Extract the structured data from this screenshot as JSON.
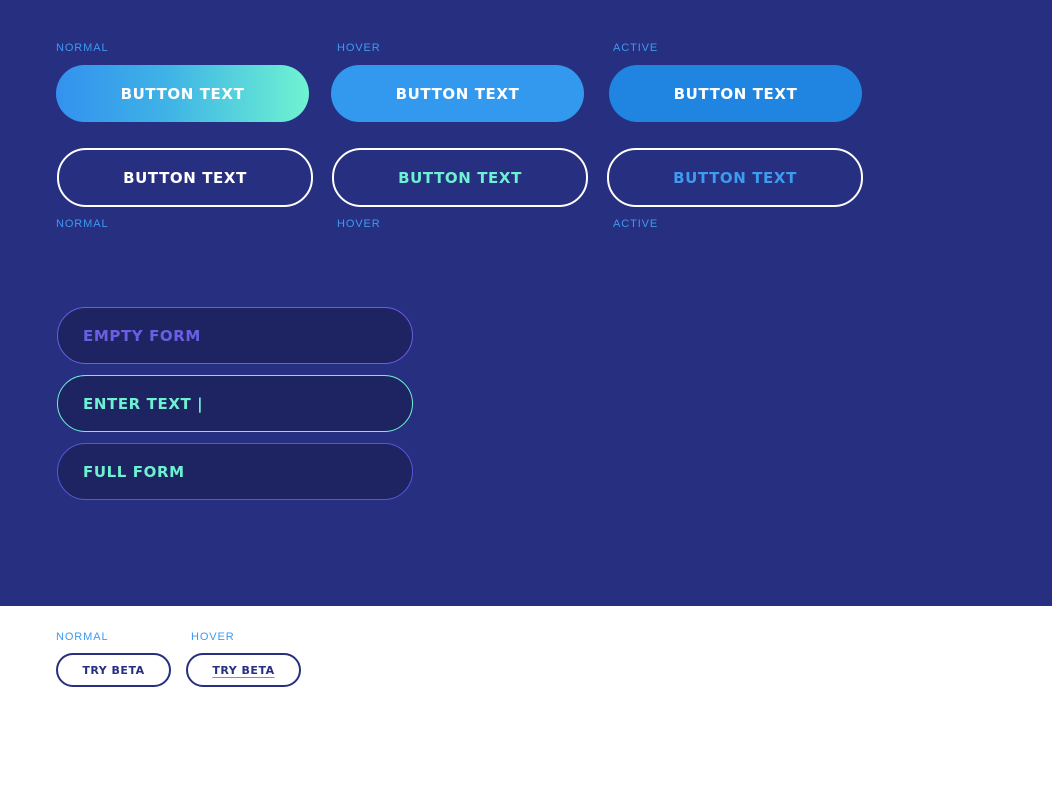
{
  "top_labels": {
    "normal": "NORMAL",
    "hover": "HOVER",
    "active": "ACTIVE"
  },
  "bottom_labels": {
    "normal": "NORMAL",
    "hover": "HOVER",
    "active": "ACTIVE"
  },
  "filled_buttons": {
    "normal": "BUTTON TEXT",
    "hover": "BUTTON TEXT",
    "active": "BUTTON TEXT"
  },
  "outline_buttons": {
    "normal": "BUTTON TEXT",
    "hover": "BUTTON TEXT",
    "active": "BUTTON TEXT"
  },
  "form_fields": {
    "empty": "EMPTY FORM",
    "typing": "ENTER TEXT |",
    "full": "FULL FORM"
  },
  "beta_section": {
    "label_normal": "NORMAL",
    "label_hover": "HOVER",
    "button_normal": "TRY BETA",
    "button_hover": "TRY BETA"
  },
  "colors": {
    "dark_background": "#272f80",
    "label_blue": "#3d9af0",
    "mint": "#6ef1d2",
    "field_background": "#1e2461",
    "placeholder_purple": "#6a5fe4"
  }
}
